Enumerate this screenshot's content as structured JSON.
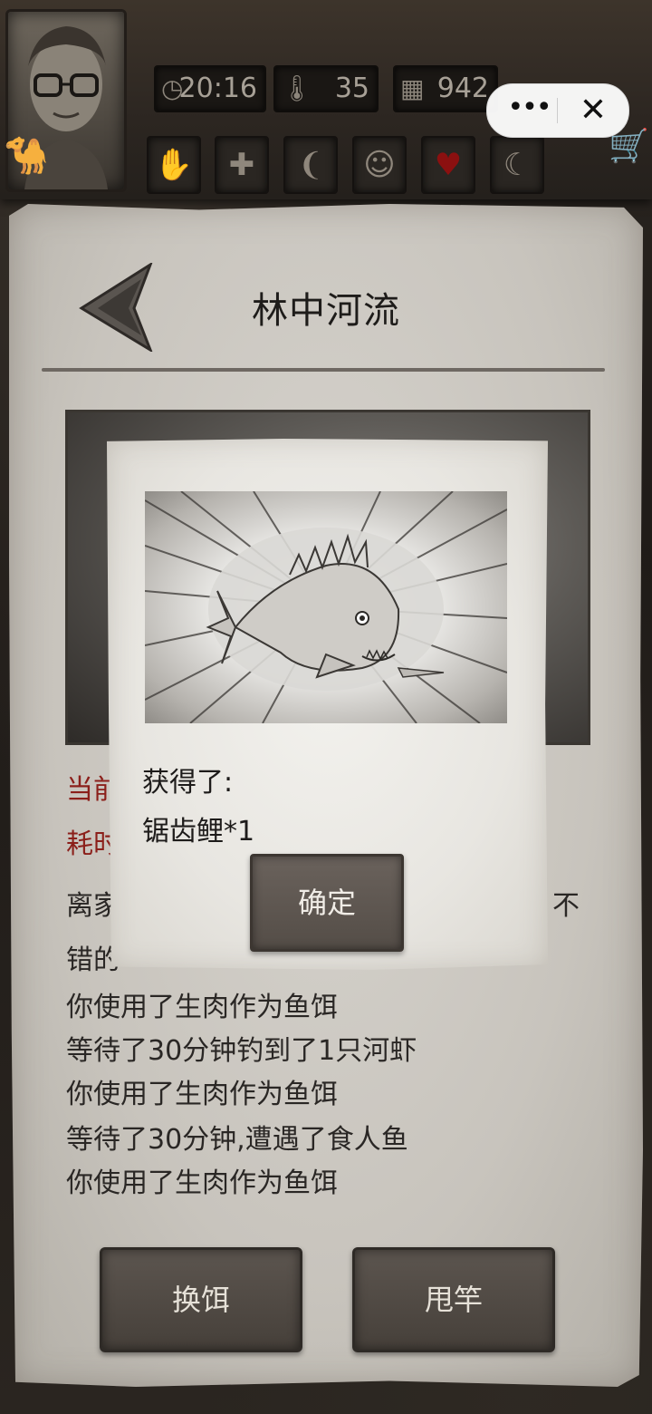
{
  "status_bar": {
    "time": "20:16",
    "temperature": "35",
    "day": "942"
  },
  "mini_program": {
    "more_label": "•••",
    "close_label": "✕"
  },
  "location": {
    "title": "林中河流"
  },
  "log": {
    "truncated_1": "当前",
    "truncated_2": "耗时",
    "truncated_3_left": "离家",
    "truncated_3_right": "不",
    "truncated_4": "错的",
    "lines": [
      "你使用了生肉作为鱼饵",
      "等待了30分钟钓到了1只河虾",
      "你使用了生肉作为鱼饵",
      "等待了30分钟,遭遇了食人鱼",
      "你使用了生肉作为鱼饵"
    ]
  },
  "actions": {
    "change_bait": "换饵",
    "cast_rod": "甩竿"
  },
  "reward_dialog": {
    "obtained_label": "获得了:",
    "item": "锯齿鲤*1",
    "confirm": "确定"
  },
  "icons": {
    "clock": "clock-icon",
    "thermometer": "thermometer-icon",
    "calendar": "calendar-icon",
    "hand": "hand-icon",
    "health": "first-aid-icon",
    "stomach": "stomach-icon",
    "head": "head-icon",
    "heart": "heart-icon",
    "moon": "moon-icon",
    "cart": "cart-icon",
    "camel": "camel-icon"
  },
  "colors": {
    "heart": "#8b1010",
    "warning_text": "#8b1f1a"
  }
}
